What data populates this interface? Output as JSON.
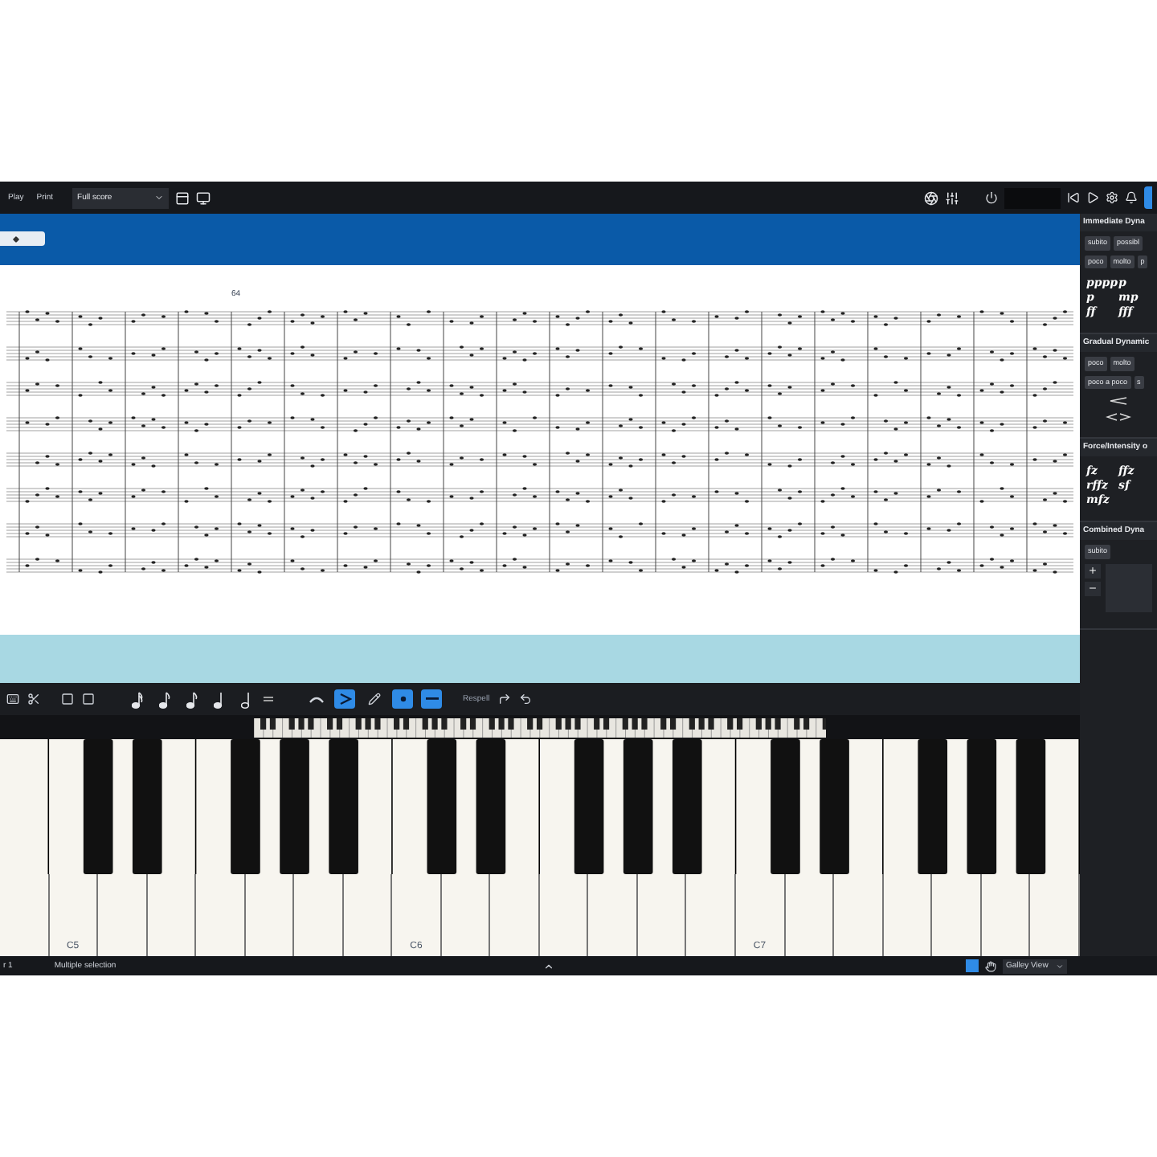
{
  "top_toolbar": {
    "tabs": [
      {
        "label": "Play",
        "selected": false
      },
      {
        "label": "Print",
        "selected": false
      }
    ],
    "layout_select": {
      "value": "Full score"
    }
  },
  "score": {
    "bar_numbers": [
      "64"
    ]
  },
  "note_input_bar": {
    "durations": [
      {
        "kind": "sixteenth",
        "selected": false
      },
      {
        "kind": "eighth",
        "selected": false
      },
      {
        "kind": "eighth",
        "selected": false
      },
      {
        "kind": "quarter",
        "selected": false
      },
      {
        "kind": "half",
        "selected": false
      }
    ],
    "tools": [
      {
        "kind": "slur",
        "selected": false
      },
      {
        "kind": "accent",
        "selected": true
      },
      {
        "kind": "pencil",
        "selected": false
      },
      {
        "kind": "dot",
        "selected": true
      },
      {
        "kind": "tenuto",
        "selected": true
      }
    ],
    "respell_label": "Respell"
  },
  "piano": {
    "octave_labels": [
      "C5",
      "C6",
      "C7"
    ]
  },
  "dynamics_panel": {
    "sections": [
      {
        "title": "Immediate Dyna",
        "pills": [
          [
            "subito",
            "possibl"
          ],
          [
            "poco",
            "molto",
            "p"
          ]
        ],
        "marks": [
          "pppp",
          "p",
          "p",
          "mp",
          "ff",
          "fff"
        ]
      },
      {
        "title": "Gradual Dynamic",
        "pills": [
          [
            "poco",
            "molto"
          ],
          [
            "poco a poco",
            "s"
          ]
        ]
      },
      {
        "title": "Force/Intensity o",
        "marks": [
          "fz",
          "ffz",
          "rffz",
          "sf",
          "mfz"
        ]
      },
      {
        "title": "Combined Dyna",
        "pills": [
          [
            "subito"
          ]
        ]
      }
    ]
  },
  "status_bar": {
    "position": "r 1",
    "selection": "Multiple selection",
    "view_select": {
      "value": "Galley View"
    }
  }
}
